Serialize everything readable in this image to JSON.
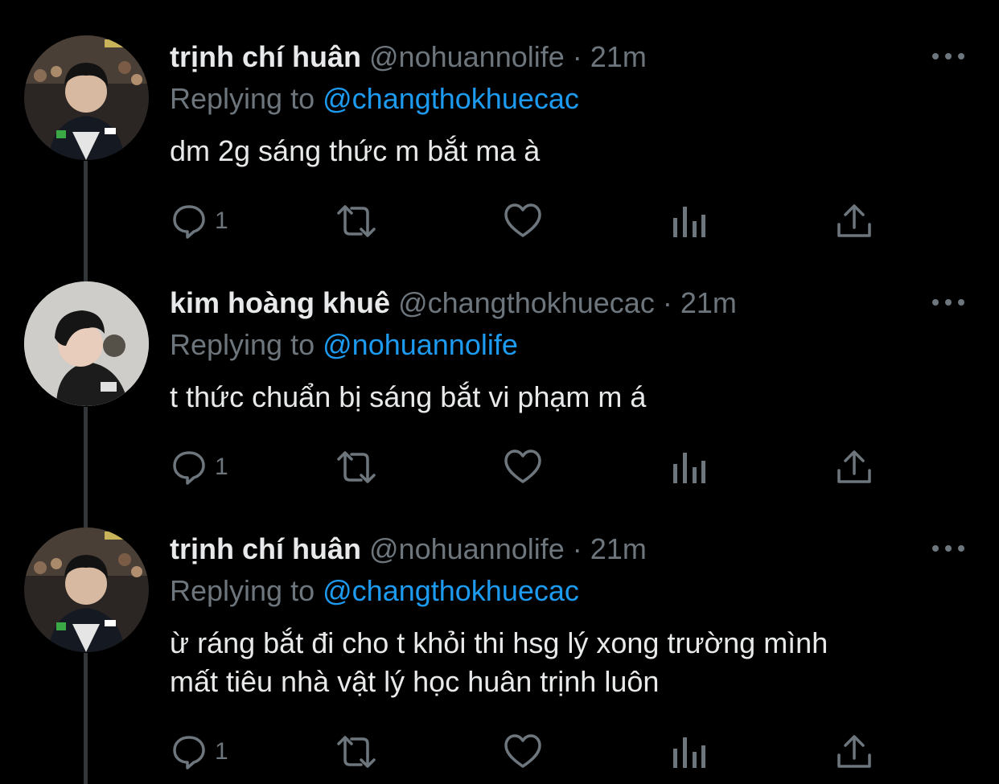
{
  "tweets": [
    {
      "name": "trịnh chí huân",
      "handle": "@nohuannolife",
      "separator": "·",
      "time": "21m",
      "replying_prefix": "Replying to",
      "replying_to": "@changthokhuecac",
      "text_lines": [
        "dm 2g sáng thức m bắt ma à"
      ],
      "reply_count": "1",
      "avatar": "photo-boy-jersey"
    },
    {
      "name": "kim hoàng khuê",
      "handle": "@changthokhuecac",
      "separator": "·",
      "time": "21m",
      "replying_prefix": "Replying to",
      "replying_to": "@nohuannolife",
      "text_lines": [
        "t thức chuẩn bị sáng bắt vi phạm m á"
      ],
      "reply_count": "1",
      "avatar": "photo-boy-profile"
    },
    {
      "name": "trịnh chí huân",
      "handle": "@nohuannolife",
      "separator": "·",
      "time": "21m",
      "replying_prefix": "Replying to",
      "replying_to": "@changthokhuecac",
      "text_lines": [
        "ừ ráng bắt đi cho t khỏi thi hsg lý xong trường mình",
        "mất tiêu nhà vật lý học huân trịnh luôn"
      ],
      "reply_count": "1",
      "avatar": "photo-boy-jersey"
    }
  ],
  "icons": {
    "reply": "reply-icon",
    "retweet": "retweet-icon",
    "like": "like-icon",
    "views": "views-icon",
    "share": "share-icon",
    "more": "more-icon"
  },
  "colors": {
    "background": "#000000",
    "primary_text": "#e7e9ea",
    "secondary_text": "#6e767d",
    "accent": "#1d9bf0",
    "thread_line": "#333639"
  }
}
